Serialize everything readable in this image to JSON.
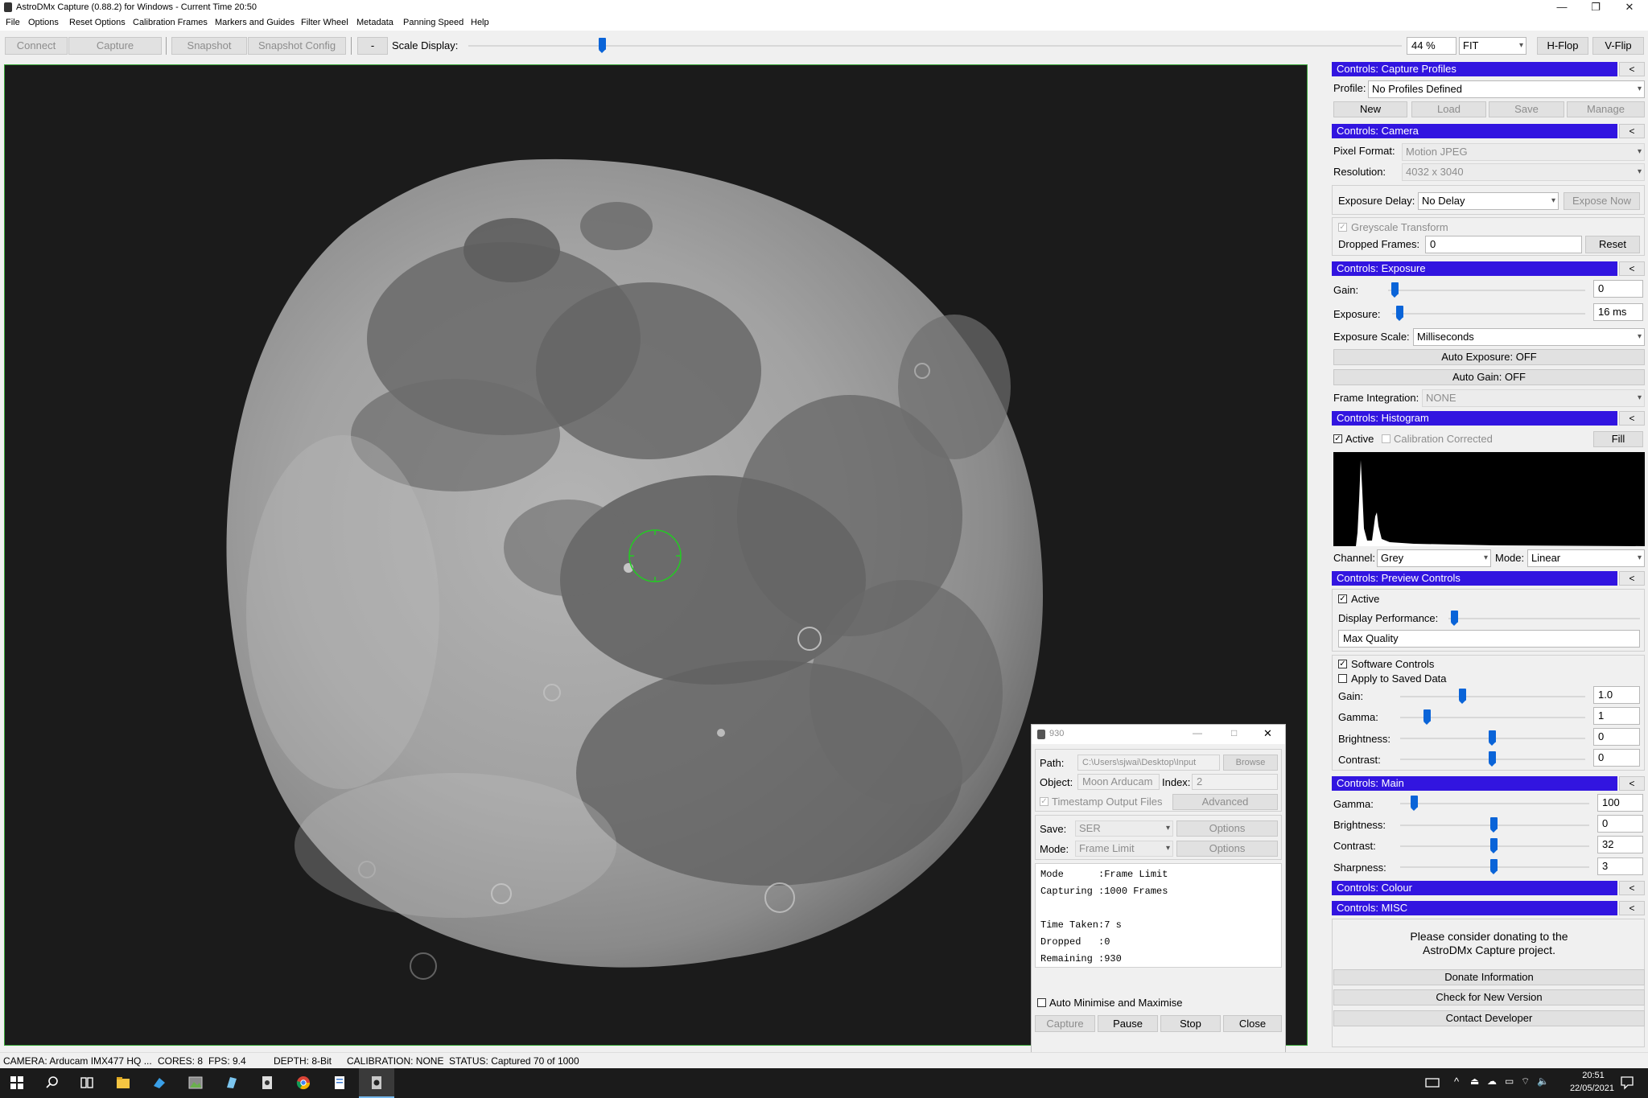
{
  "window": {
    "title": "AstroDMx Capture (0.88.2) for Windows - Current Time 20:50",
    "controls": {
      "minimize": "—",
      "restore": "❐",
      "close": "✕"
    }
  },
  "menu": [
    "File",
    "Options",
    "Reset Options",
    "Calibration Frames",
    "Markers and Guides",
    "Filter Wheel",
    "Metadata",
    "Panning Speed",
    "Help"
  ],
  "toolbar": {
    "connect": "Connect",
    "capture": "Capture",
    "snapshot": "Snapshot",
    "snapshot_config": "Snapshot Config",
    "minus": "-",
    "scale_label": "Scale Display:",
    "scale_value": 0.26,
    "zoom": "44 %",
    "fit": "FIT",
    "hflop": "H-Flop",
    "vflip": "V-Flip"
  },
  "panels": {
    "profiles": {
      "title": "Controls: Capture Profiles",
      "collapse": "<",
      "profile_label": "Profile:",
      "profile_value": "No Profiles Defined",
      "new": "New",
      "load": "Load",
      "save": "Save",
      "manage": "Manage"
    },
    "camera": {
      "title": "Controls: Camera",
      "collapse": "<",
      "pixel_format_label": "Pixel Format:",
      "pixel_format": "Motion JPEG",
      "resolution_label": "Resolution:",
      "resolution": "4032 x 3040",
      "exposure_delay_label": "Exposure Delay:",
      "exposure_delay": "No Delay",
      "expose_now": "Expose Now",
      "greyscale": "Greyscale Transform",
      "dropped_label": "Dropped Frames:",
      "dropped": "0",
      "reset": "Reset"
    },
    "exposure": {
      "title": "Controls: Exposure",
      "collapse": "<",
      "gain_label": "Gain:",
      "gain": "0",
      "exposure_label": "Exposure:",
      "exposure": "16 ms",
      "scale_label": "Exposure Scale:",
      "scale": "Milliseconds",
      "auto_exposure": "Auto Exposure: OFF",
      "auto_gain": "Auto Gain: OFF",
      "frame_integration_label": "Frame Integration:",
      "frame_integration": "NONE"
    },
    "histogram": {
      "title": "Controls: Histogram",
      "collapse": "<",
      "active": "Active",
      "calibration": "Calibration Corrected",
      "fill": "Fill",
      "channel_label": "Channel:",
      "channel": "Grey",
      "mode_label": "Mode:",
      "mode": "Linear"
    },
    "preview": {
      "title": "Controls: Preview Controls",
      "collapse": "<",
      "active": "Active",
      "display_perf_label": "Display Performance:",
      "quality": "Max Quality",
      "software_controls": "Software Controls",
      "apply_saved": "Apply to Saved Data",
      "gain_label": "Gain:",
      "gain": "1.0",
      "gamma_label": "Gamma:",
      "gamma": "1",
      "brightness_label": "Brightness:",
      "brightness": "0",
      "contrast_label": "Contrast:",
      "contrast": "0"
    },
    "main": {
      "title": "Controls: Main",
      "collapse": "<",
      "gamma_label": "Gamma:",
      "gamma": "100",
      "brightness_label": "Brightness:",
      "brightness": "0",
      "contrast_label": "Contrast:",
      "contrast": "32",
      "sharpness_label": "Sharpness:",
      "sharpness": "3"
    },
    "colour": {
      "title": "Controls: Colour",
      "collapse": "<"
    },
    "misc": {
      "title": "Controls: MISC",
      "collapse": "<"
    },
    "donate": {
      "line1": "Please consider donating to the",
      "line2": "AstroDMx Capture project.",
      "donate_info": "Donate Information",
      "check_version": "Check for New Version",
      "contact": "Contact Developer"
    }
  },
  "capture_dialog": {
    "title": "930",
    "path_label": "Path:",
    "path": "C:\\Users\\sjwai\\Desktop\\Input",
    "browse": "Browse",
    "object_label": "Object:",
    "object": "Moon Arducam",
    "index_label": "Index:",
    "index": "2",
    "timestamp": "Timestamp Output Files",
    "advanced": "Advanced",
    "save_label": "Save:",
    "save": "SER",
    "mode_label": "Mode:",
    "mode": "Frame Limit",
    "options": "Options",
    "log": [
      "Mode      :Frame Limit",
      "Capturing :1000 Frames",
      "",
      "Time Taken:7 s",
      "Dropped   :0",
      "Remaining :930"
    ],
    "auto_minimise": "Auto Minimise and Maximise",
    "capture": "Capture",
    "pause": "Pause",
    "stop": "Stop",
    "close": "Close"
  },
  "status": {
    "camera": "CAMERA: Arducam IMX477 HQ ...",
    "cores": "CORES: 8",
    "fps": "FPS: 9.4",
    "depth": "DEPTH: 8-Bit",
    "calibration": "CALIBRATION: NONE",
    "status": "STATUS: Captured 70 of 1000"
  },
  "taskbar": {
    "time": "20:51",
    "date": "22/05/2021"
  },
  "colors": {
    "panel_header": "#3215e0",
    "slider_thumb": "#0a64d8",
    "reticle": "#22cc22"
  }
}
